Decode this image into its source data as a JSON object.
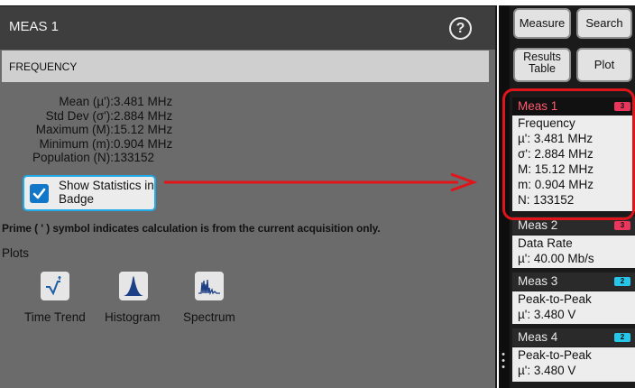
{
  "dialog": {
    "title": "MEAS 1",
    "section_title": "FREQUENCY",
    "stats": [
      {
        "label": "Mean (µ'):",
        "value": "3.481 MHz"
      },
      {
        "label": "Std Dev (σ'):",
        "value": "2.884 MHz"
      },
      {
        "label": "Maximum (M):",
        "value": "15.12 MHz"
      },
      {
        "label": "Minimum (m):",
        "value": "0.904 MHz"
      },
      {
        "label": "Population (N):",
        "value": "133152"
      }
    ],
    "show_stats_label": "Show Statistics in Badge",
    "show_stats_checked": true,
    "prime_note": "Prime ( ' ) symbol indicates calculation is from the current acquisition only.",
    "plots_label": "Plots",
    "plots": [
      {
        "label": "Time Trend",
        "icon": "time-trend-icon"
      },
      {
        "label": "Histogram",
        "icon": "histogram-icon"
      },
      {
        "label": "Spectrum",
        "icon": "spectrum-icon"
      }
    ]
  },
  "right_panel": {
    "buttons": {
      "measure": "Measure",
      "search": "Search",
      "results_table": "Results Table",
      "plot": "Plot"
    },
    "badges": [
      {
        "title": "Meas 1",
        "count": "3",
        "count_color": "#e8365d",
        "lines": [
          "Frequency",
          "µ': 3.481 MHz",
          "σ': 2.884 MHz",
          "M: 15.12 MHz",
          "m: 0.904 MHz",
          "N: 133152"
        ]
      },
      {
        "title": "Meas 2",
        "count": "3",
        "count_color": "#e8365d",
        "lines": [
          "Data Rate",
          "µ': 40.00 Mb/s"
        ]
      },
      {
        "title": "Meas 3",
        "count": "2",
        "count_color": "#27c6e8",
        "lines": [
          "Peak-to-Peak",
          "µ': 3.480 V"
        ]
      },
      {
        "title": "Meas 4",
        "count": "2",
        "count_color": "#27c6e8",
        "lines": [
          "Peak-to-Peak",
          "µ': 3.480 V"
        ]
      }
    ]
  },
  "colors": {
    "accent_blue": "#1277c9",
    "highlight_red": "#e0151b",
    "dialog_bg": "#6b6b6b"
  }
}
